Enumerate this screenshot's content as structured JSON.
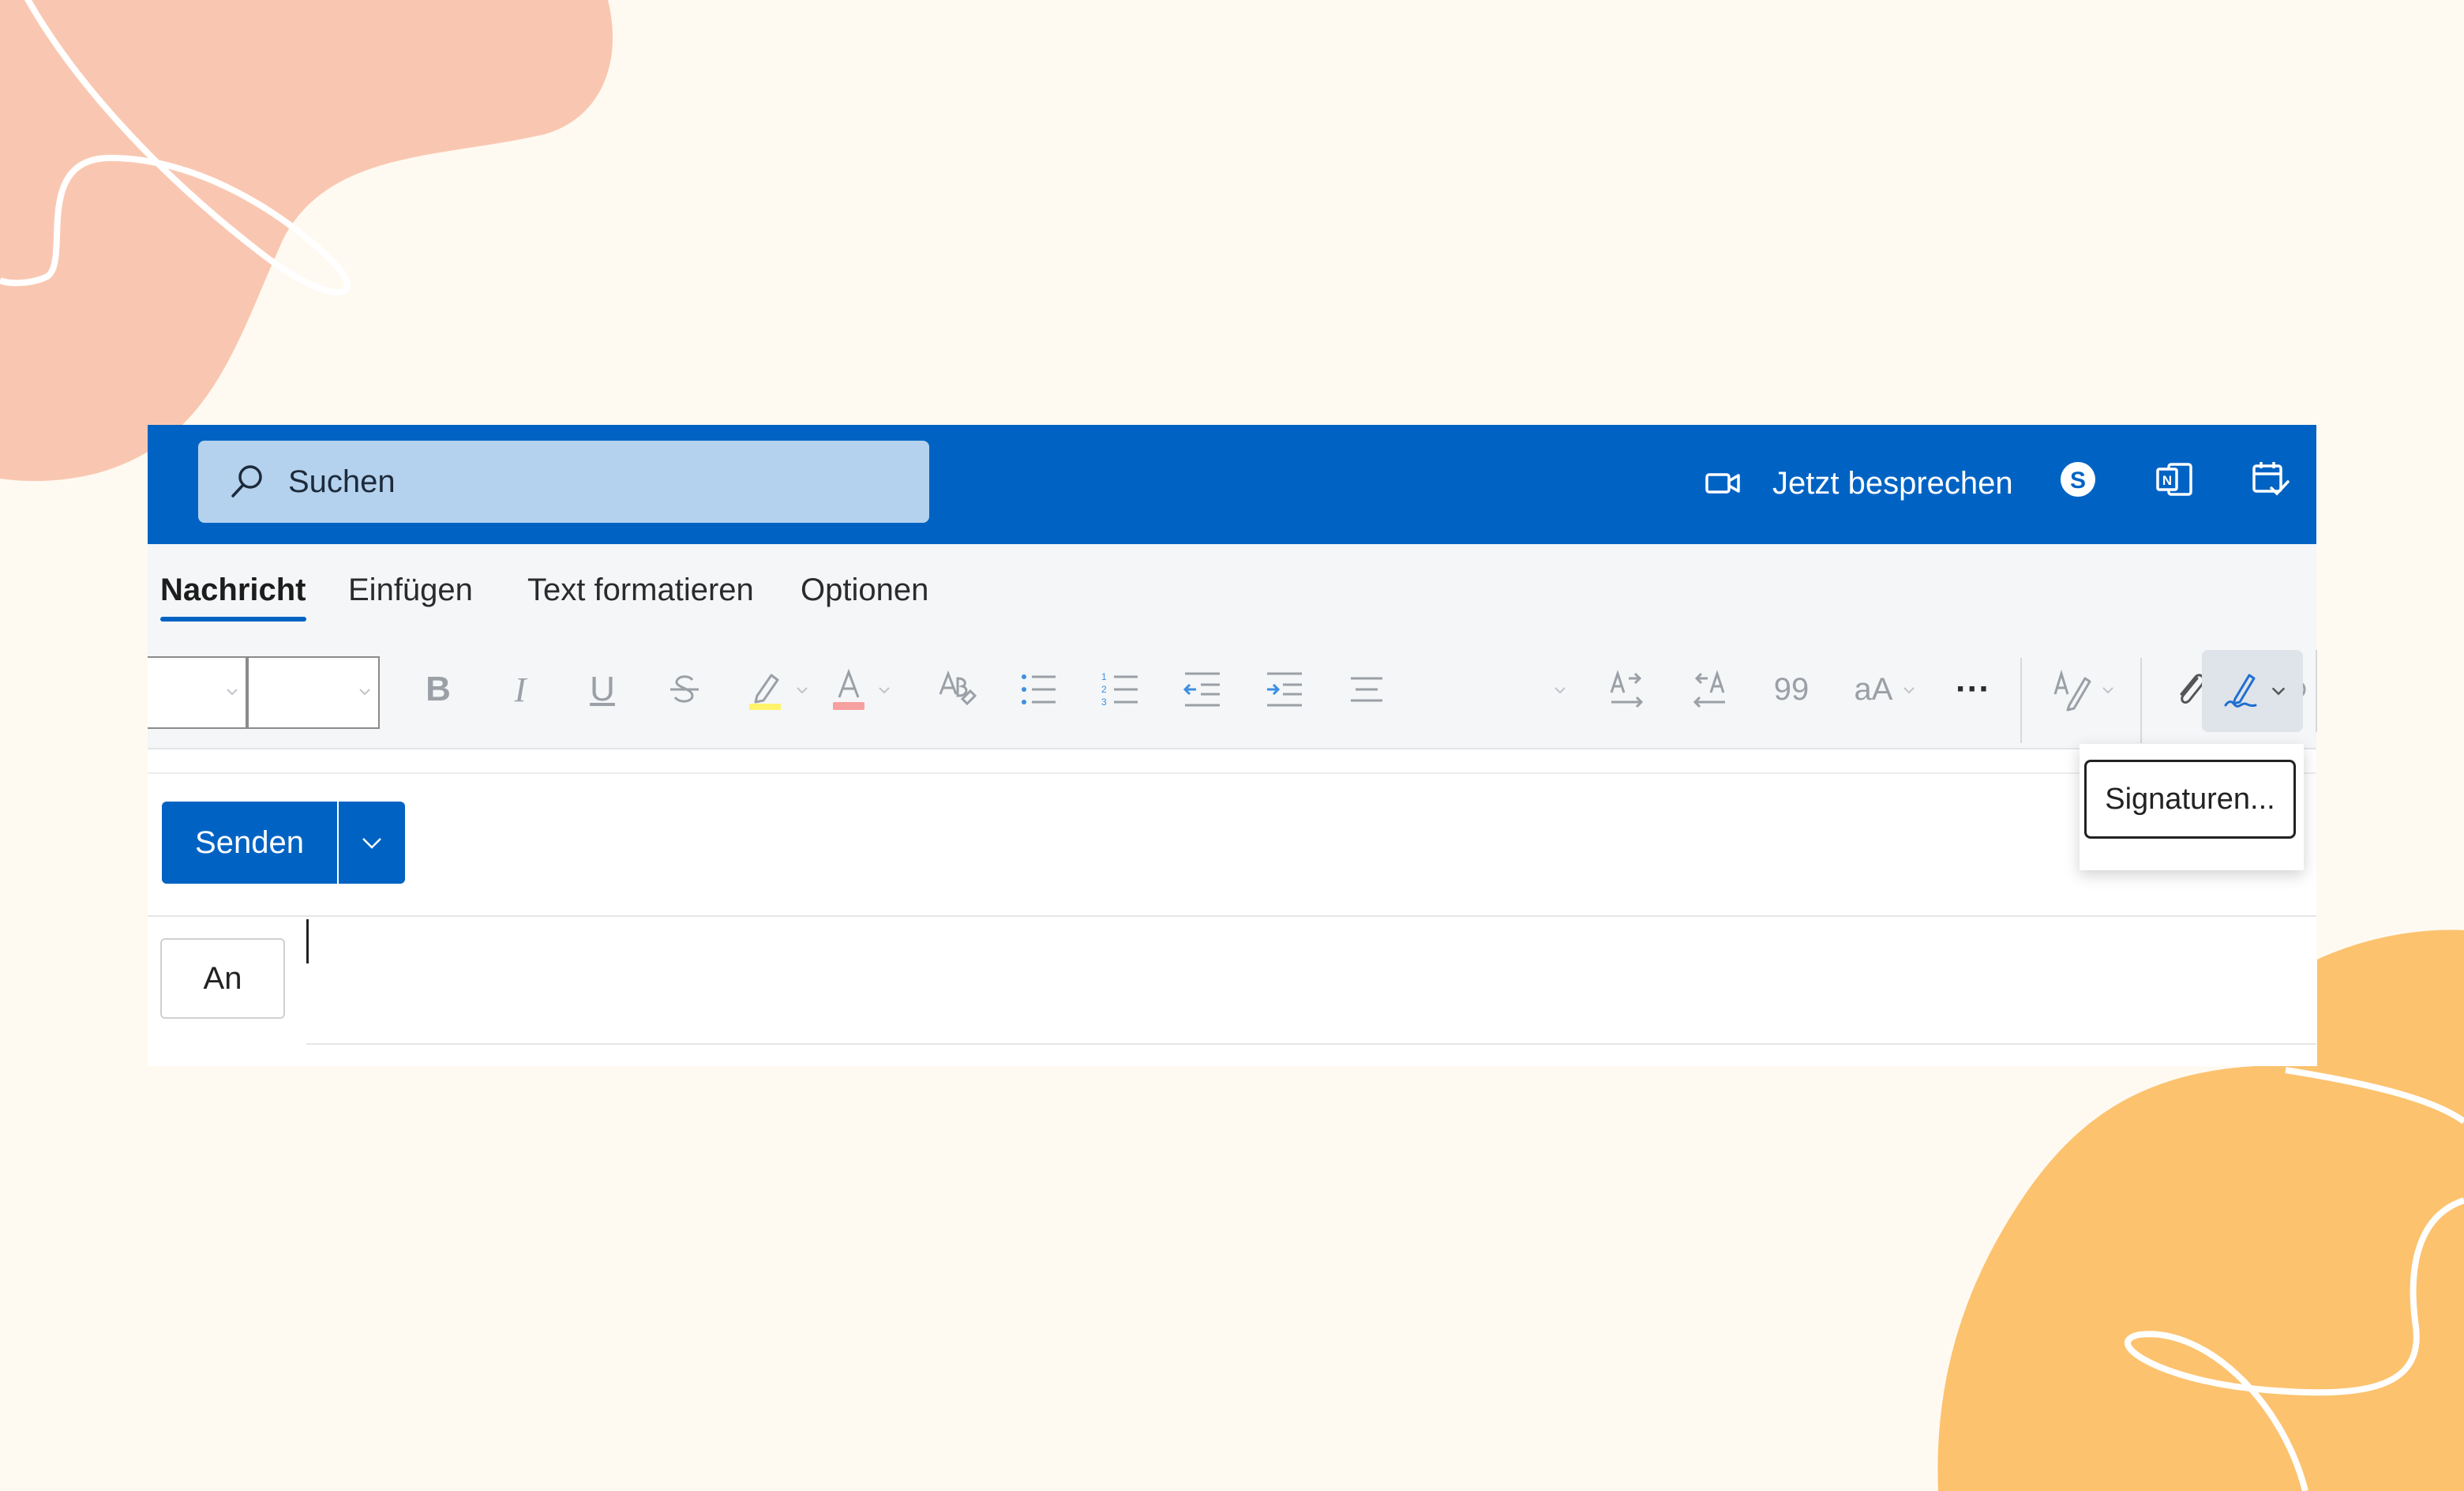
{
  "colors": {
    "brand_blue": "#0063c4",
    "search_bg": "#b4d2ee",
    "ribbon_bg": "#f4f6f8",
    "deco_pink": "#f9c7b1",
    "deco_orange": "#fcc26e",
    "page_bg": "#fffaf1"
  },
  "topbar": {
    "search_placeholder": "Suchen",
    "meet_now_label": "Jetzt besprechen",
    "icons": [
      "search-icon",
      "video-icon",
      "skype-icon",
      "onenote-icon",
      "calendar-check-icon"
    ]
  },
  "tabs": [
    {
      "label": "Nachricht",
      "active": true
    },
    {
      "label": "Einfügen",
      "active": false
    },
    {
      "label": "Text formatieren",
      "active": false
    },
    {
      "label": "Optionen",
      "active": false
    }
  ],
  "toolbar": {
    "font_name_value": "",
    "font_size_value": "",
    "bold_glyph": "B",
    "italic_glyph": "I",
    "underline_glyph": "U",
    "more_glyph": "···",
    "size_glyph": "aA",
    "quote_glyph": "99",
    "icons": [
      "bold-icon",
      "italic-icon",
      "underline-icon",
      "strikethrough-icon",
      "highlight-icon",
      "font-color-icon",
      "clear-format-icon",
      "bullet-list-icon",
      "numbered-list-icon",
      "decrease-indent-icon",
      "increase-indent-icon",
      "align-icon",
      "ltr-icon",
      "rtl-icon",
      "quote-icon",
      "font-size-icon",
      "more-icon",
      "editor-icon",
      "attach-icon",
      "link-icon",
      "signature-icon"
    ]
  },
  "signature_menu": {
    "item_label": "Signaturen..."
  },
  "compose": {
    "send_label": "Senden",
    "to_label": "An",
    "to_value": ""
  }
}
